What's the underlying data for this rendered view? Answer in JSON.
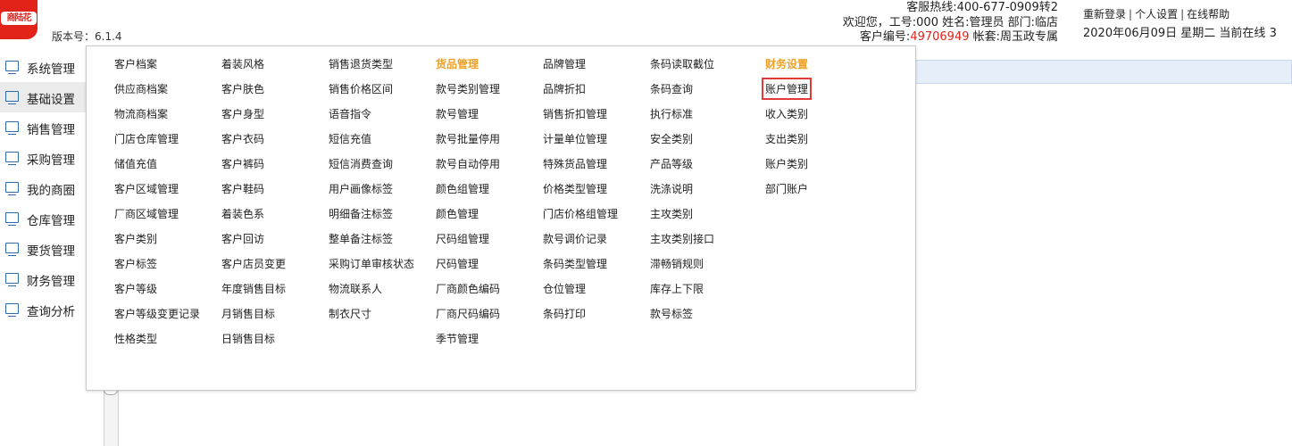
{
  "header": {
    "logo_text": "商陆花",
    "version": "版本号：6.1.4",
    "hotline": "客服热线:400-677-0909转2",
    "welcome": "欢迎您，工号:000 姓名:管理员 部门:临店",
    "customer_no_label": "客户编号:",
    "customer_no": "49706949",
    "account_set": " 帐套:周玉政专属",
    "links": [
      "重新登录",
      "个人设置",
      "在线帮助"
    ],
    "link_separator": "|",
    "date_status": "2020年06月09日 星期二 当前在线 3"
  },
  "sidebar": {
    "items": [
      {
        "label": "系统管理",
        "icon": "monitor-icon"
      },
      {
        "label": "基础设置",
        "icon": "monitor-icon",
        "active": true
      },
      {
        "label": "销售管理",
        "icon": "monitor-icon"
      },
      {
        "label": "采购管理",
        "icon": "monitor-icon"
      },
      {
        "label": "我的商圈",
        "icon": "monitor-icon"
      },
      {
        "label": "仓库管理",
        "icon": "monitor-icon"
      },
      {
        "label": "要货管理",
        "icon": "monitor-icon"
      },
      {
        "label": "财务管理",
        "icon": "monitor-icon"
      },
      {
        "label": "查询分析",
        "icon": "monitor-icon"
      }
    ]
  },
  "menu": {
    "columns": [
      {
        "items": [
          "客户档案",
          "供应商档案",
          "物流商档案",
          "门店仓库管理",
          "储值充值",
          "客户区域管理",
          "厂商区域管理",
          "客户类别",
          "客户标签",
          "客户等级",
          "客户等级变更记录",
          "性格类型"
        ]
      },
      {
        "items": [
          "着装风格",
          "客户肤色",
          "客户身型",
          "客户衣码",
          "客户裤码",
          "客户鞋码",
          "着装色系",
          "客户回访",
          "客户店员变更",
          "年度销售目标",
          "月销售目标",
          "日销售目标"
        ]
      },
      {
        "items": [
          "销售退货类型",
          "销售价格区间",
          "语音指令",
          "短信充值",
          "短信消费查询",
          "用户画像标签",
          "明细备注标签",
          "整单备注标签",
          "采购订单审核状态",
          "物流联系人",
          "制衣尺寸"
        ]
      },
      {
        "heading": "货品管理",
        "items": [
          "款号类别管理",
          "款号管理",
          "款号批量停用",
          "款号自动停用",
          "颜色组管理",
          "颜色管理",
          "尺码组管理",
          "尺码管理",
          "厂商颜色编码",
          "厂商尺码编码",
          "季节管理"
        ]
      },
      {
        "items": [
          "品牌管理",
          "品牌折扣",
          "销售折扣管理",
          "计量单位管理",
          "特殊货品管理",
          "价格类型管理",
          "门店价格组管理",
          "款号调价记录",
          "条码类型管理",
          "仓位管理",
          "条码打印"
        ]
      },
      {
        "items": [
          "条码读取截位",
          "条码查询",
          "执行标准",
          "安全类别",
          "产品等级",
          "洗涤说明",
          "主攻类别",
          "主攻类别接口",
          "滞畅销规则",
          "库存上下限",
          "款号标签"
        ]
      },
      {
        "heading": "财务设置",
        "items": [
          "账户管理",
          "收入类别",
          "支出类别",
          "账户类别",
          "部门账户"
        ],
        "highlighted_item": "账户管理"
      }
    ]
  },
  "colors": {
    "brand_red": "#e2231a",
    "heading_orange": "#f0a023",
    "highlight_box": "#e23a3a",
    "icon_blue": "#2b6cb0",
    "sidebar_active_bg": "#ebebeb"
  }
}
